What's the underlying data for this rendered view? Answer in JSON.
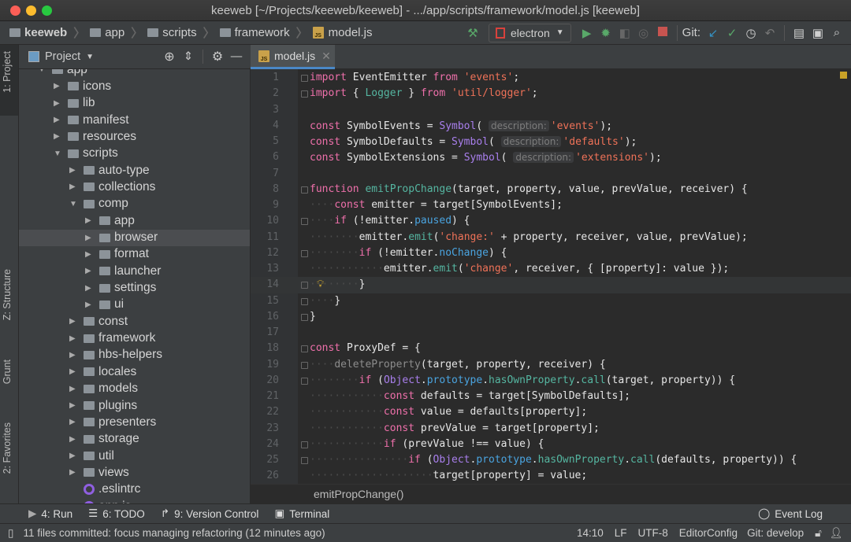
{
  "window": {
    "title": "keeweb [~/Projects/keeweb/keeweb] - .../app/scripts/framework/model.js [keeweb]"
  },
  "breadcrumb": [
    "keeweb",
    "app",
    "scripts",
    "framework",
    "model.js"
  ],
  "toolbar": {
    "run_config": "electron",
    "git_label": "Git:",
    "icons": [
      "hammer-icon",
      "run-icon",
      "debug-icon",
      "coverage-icon",
      "profile-icon",
      "stop-icon",
      "git-update-icon",
      "git-commit-icon",
      "history-icon",
      "revert-icon",
      "project-structure-icon",
      "terminal-icon",
      "search-icon"
    ]
  },
  "left_stripe": {
    "project": "1: Project",
    "structure": "Z: Structure",
    "grunt": "Grunt",
    "favorites": "2: Favorites"
  },
  "project_panel": {
    "title": "Project"
  },
  "tree": [
    {
      "name": "app",
      "level": 0,
      "open": true
    },
    {
      "name": "icons",
      "level": 1
    },
    {
      "name": "lib",
      "level": 1
    },
    {
      "name": "manifest",
      "level": 1
    },
    {
      "name": "resources",
      "level": 1
    },
    {
      "name": "scripts",
      "level": 1,
      "open": true
    },
    {
      "name": "auto-type",
      "level": 2
    },
    {
      "name": "collections",
      "level": 2
    },
    {
      "name": "comp",
      "level": 2,
      "open": true
    },
    {
      "name": "app",
      "level": 3
    },
    {
      "name": "browser",
      "level": 3,
      "selected": true
    },
    {
      "name": "format",
      "level": 3
    },
    {
      "name": "launcher",
      "level": 3
    },
    {
      "name": "settings",
      "level": 3
    },
    {
      "name": "ui",
      "level": 3
    },
    {
      "name": "const",
      "level": 2
    },
    {
      "name": "framework",
      "level": 2
    },
    {
      "name": "hbs-helpers",
      "level": 2
    },
    {
      "name": "locales",
      "level": 2
    },
    {
      "name": "models",
      "level": 2
    },
    {
      "name": "plugins",
      "level": 2
    },
    {
      "name": "presenters",
      "level": 2
    },
    {
      "name": "storage",
      "level": 2
    },
    {
      "name": "util",
      "level": 2
    },
    {
      "name": "views",
      "level": 2
    },
    {
      "name": ".eslintrc",
      "level": 2,
      "file": true
    },
    {
      "name": "app.js",
      "level": 2,
      "file": true
    }
  ],
  "editor": {
    "tab": "model.js",
    "current_line": 14,
    "lines": [
      {
        "i": 0,
        "t": [
          [
            "k",
            "import"
          ],
          [
            "t",
            " EventEmitter "
          ],
          [
            "k",
            "from"
          ],
          [
            "t",
            " "
          ],
          [
            "s",
            "'events'"
          ],
          [
            "t",
            ";"
          ]
        ]
      },
      {
        "i": 0,
        "t": [
          [
            "k",
            "import"
          ],
          [
            "t",
            " { "
          ],
          [
            "f",
            "Logger"
          ],
          [
            "t",
            " } "
          ],
          [
            "k",
            "from"
          ],
          [
            "t",
            " "
          ],
          [
            "s",
            "'util/logger'"
          ],
          [
            "t",
            ";"
          ]
        ]
      },
      {
        "i": 0,
        "t": []
      },
      {
        "i": 0,
        "t": [
          [
            "k",
            "const"
          ],
          [
            "t",
            " SymbolEvents = "
          ],
          [
            "c",
            "Symbol"
          ],
          [
            "t",
            "( "
          ],
          [
            "h",
            "description:"
          ],
          [
            "s",
            "'events'"
          ],
          [
            "t",
            ");"
          ]
        ]
      },
      {
        "i": 0,
        "t": [
          [
            "k",
            "const"
          ],
          [
            "t",
            " SymbolDefaults = "
          ],
          [
            "c",
            "Symbol"
          ],
          [
            "t",
            "( "
          ],
          [
            "h",
            "description:"
          ],
          [
            "s",
            "'defaults'"
          ],
          [
            "t",
            ");"
          ]
        ]
      },
      {
        "i": 0,
        "t": [
          [
            "k",
            "const"
          ],
          [
            "t",
            " SymbolExtensions = "
          ],
          [
            "c",
            "Symbol"
          ],
          [
            "t",
            "( "
          ],
          [
            "h",
            "description:"
          ],
          [
            "s",
            "'extensions'"
          ],
          [
            "t",
            ");"
          ]
        ]
      },
      {
        "i": 0,
        "t": []
      },
      {
        "i": 0,
        "t": [
          [
            "k",
            "function"
          ],
          [
            "t",
            " "
          ],
          [
            "f",
            "emitPropChange"
          ],
          [
            "t",
            "(target, property, value, prevValue, receiver) {"
          ]
        ]
      },
      {
        "i": 4,
        "t": [
          [
            "k",
            "const"
          ],
          [
            "t",
            " emitter = target[SymbolEvents];"
          ]
        ]
      },
      {
        "i": 4,
        "t": [
          [
            "k",
            "if"
          ],
          [
            "t",
            " (!emitter."
          ],
          [
            "p",
            "paused"
          ],
          [
            "t",
            ") {"
          ]
        ]
      },
      {
        "i": 8,
        "t": [
          [
            "t",
            "emitter."
          ],
          [
            "f",
            "emit"
          ],
          [
            "t",
            "("
          ],
          [
            "s",
            "'change:'"
          ],
          [
            "t",
            " + property, receiver, value, prevValue);"
          ]
        ]
      },
      {
        "i": 8,
        "t": [
          [
            "k",
            "if"
          ],
          [
            "t",
            " (!emitter."
          ],
          [
            "p",
            "noChange"
          ],
          [
            "t",
            ") {"
          ]
        ]
      },
      {
        "i": 12,
        "t": [
          [
            "t",
            "emitter."
          ],
          [
            "f",
            "emit"
          ],
          [
            "t",
            "("
          ],
          [
            "s",
            "'change'"
          ],
          [
            "t",
            ", receiver, { [property]: value });"
          ]
        ]
      },
      {
        "i": 8,
        "t": [
          [
            "t",
            "}"
          ]
        ]
      },
      {
        "i": 4,
        "t": [
          [
            "t",
            "}"
          ]
        ]
      },
      {
        "i": 0,
        "t": [
          [
            "t",
            "}"
          ]
        ]
      },
      {
        "i": 0,
        "t": []
      },
      {
        "i": 0,
        "t": [
          [
            "k",
            "const"
          ],
          [
            "t",
            " ProxyDef = {"
          ]
        ]
      },
      {
        "i": 4,
        "t": [
          [
            "g",
            "deleteProperty"
          ],
          [
            "t",
            "(target, property, receiver) {"
          ]
        ]
      },
      {
        "i": 8,
        "t": [
          [
            "k",
            "if"
          ],
          [
            "t",
            " ("
          ],
          [
            "c",
            "Object"
          ],
          [
            "t",
            "."
          ],
          [
            "p",
            "prototype"
          ],
          [
            "t",
            "."
          ],
          [
            "f",
            "hasOwnProperty"
          ],
          [
            "t",
            "."
          ],
          [
            "f",
            "call"
          ],
          [
            "t",
            "(target, property)) {"
          ]
        ]
      },
      {
        "i": 12,
        "t": [
          [
            "k",
            "const"
          ],
          [
            "t",
            " defaults = target[SymbolDefaults];"
          ]
        ]
      },
      {
        "i": 12,
        "t": [
          [
            "k",
            "const"
          ],
          [
            "t",
            " value = defaults[property];"
          ]
        ]
      },
      {
        "i": 12,
        "t": [
          [
            "k",
            "const"
          ],
          [
            "t",
            " prevValue = target[property];"
          ]
        ]
      },
      {
        "i": 12,
        "t": [
          [
            "k",
            "if"
          ],
          [
            "t",
            " (prevValue !== value) {"
          ]
        ]
      },
      {
        "i": 16,
        "t": [
          [
            "k",
            "if"
          ],
          [
            "t",
            " ("
          ],
          [
            "c",
            "Object"
          ],
          [
            "t",
            "."
          ],
          [
            "p",
            "prototype"
          ],
          [
            "t",
            "."
          ],
          [
            "f",
            "hasOwnProperty"
          ],
          [
            "t",
            "."
          ],
          [
            "f",
            "call"
          ],
          [
            "t",
            "(defaults, property)) {"
          ]
        ]
      },
      {
        "i": 20,
        "t": [
          [
            "t",
            "target[property] = value;"
          ]
        ]
      }
    ],
    "fold_lines": [
      1,
      2,
      8,
      10,
      12,
      14,
      15,
      16,
      18,
      19,
      20,
      24,
      25
    ],
    "breadcrumb": "emitPropChange()"
  },
  "tool_windows": {
    "run": "4: Run",
    "todo": "6: TODO",
    "vcs": "9: Version Control",
    "terminal": "Terminal",
    "event_log": "Event Log"
  },
  "status": {
    "message": "11 files committed: focus managing refactoring (12 minutes ago)",
    "position": "14:10",
    "line_sep": "LF",
    "encoding": "UTF-8",
    "editorconfig": "EditorConfig",
    "git_branch": "Git: develop"
  }
}
